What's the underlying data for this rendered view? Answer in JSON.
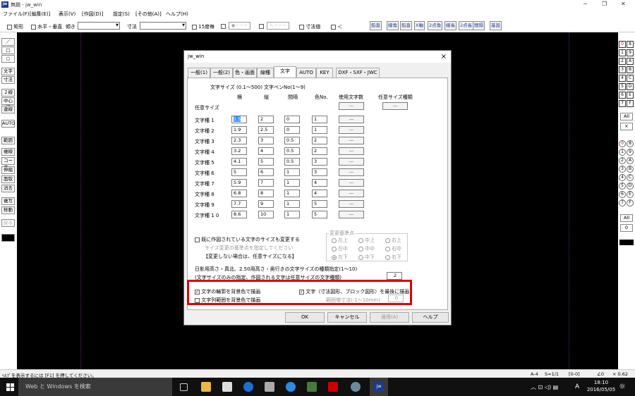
{
  "window": {
    "title": "無題 - jw_win",
    "logo": "jw"
  },
  "menu": [
    "ファイル(F)",
    "[編集(E)]",
    "表示(V)",
    "[作図(D)]",
    "設定(S)",
    "[その他(A)]",
    "ヘルプ(H)"
  ],
  "toolbar": {
    "rect": "矩形",
    "hv": "水平・垂直",
    "tilt": "傾き",
    "dim": "寸法",
    "deg15": "15度毎",
    "dots1": "●－－－",
    "dots2": "＜－－－",
    "dimval": "寸法値",
    "lt": "＜",
    "buttons": [
      "鉛直",
      "線角",
      "鉛直",
      "X軸",
      "2点角",
      "線長",
      "2点長",
      "間隔",
      "基設"
    ]
  },
  "left_tools": [
    "／",
    "□",
    "○",
    "文字",
    "寸法",
    "２線",
    "中心線",
    "連線",
    "AUTO",
    "範囲",
    "複線",
    "コーナー",
    "伸縮",
    "面取",
    "消去",
    "複写",
    "移動",
    "戻る",
    "━"
  ],
  "right_tools": {
    "sq": [
      "0",
      "1",
      "2",
      "3",
      "4",
      "5",
      "6",
      "7"
    ],
    "sq2": [
      "8",
      "9",
      "A",
      "B",
      "C",
      "D",
      "E",
      "F"
    ],
    "all1": "All",
    "x": "×",
    "circ": [
      "0",
      "1",
      "2",
      "3",
      "4",
      "5",
      "6",
      "7"
    ],
    "circ2": [
      "8",
      "9",
      "A",
      "B",
      "C",
      "D",
      "E",
      "F"
    ],
    "all2": "All",
    "zero": "0"
  },
  "status": {
    "help": "ﾍﾙﾌﾟを表示するには [F1] を押してください。",
    "paper": "A-4",
    "scale": "S=1/1",
    "layer": "[0-0]",
    "angle": "∠0",
    "zoom": "× 0.62"
  },
  "taskbar": {
    "search": "Web と Windows を検索",
    "time": "18:10",
    "date": "2016/05/05",
    "lang": "A"
  },
  "dialog": {
    "title": "jw_win",
    "close": "×",
    "tabs": [
      "一般(1)",
      "一般(2)",
      "色・画面",
      "線種",
      "文字",
      "AUTO",
      "KEY",
      "DXF・SXF・JWC"
    ],
    "hdr1": "文字サイズ (0.1～500)",
    "hdr2": "文字ペンNo(1～9)",
    "cols": [
      "横",
      "縦",
      "間隔",
      "色No.",
      "使用文字数",
      "任意サイズ種類"
    ],
    "free_label": "任意サイズ",
    "free_used": "---",
    "free_kind": "---",
    "rows": [
      {
        "label": "文字種 1",
        "w": "1.5",
        "h": "2",
        "gap": "0",
        "color": "1",
        "used": "---"
      },
      {
        "label": "文字種 2",
        "w": "1.9",
        "h": "2.5",
        "gap": "0",
        "color": "1",
        "used": "---"
      },
      {
        "label": "文字種 3",
        "w": "2.3",
        "h": "3",
        "gap": "0.5",
        "color": "2",
        "used": "---"
      },
      {
        "label": "文字種 4",
        "w": "3.2",
        "h": "4",
        "gap": "0.5",
        "color": "2",
        "used": "---"
      },
      {
        "label": "文字種 5",
        "w": "4.1",
        "h": "5",
        "gap": "0.5",
        "color": "3",
        "used": "---"
      },
      {
        "label": "文字種 6",
        "w": "5",
        "h": "6",
        "gap": "1",
        "color": "3",
        "used": "---"
      },
      {
        "label": "文字種 7",
        "w": "5.9",
        "h": "7",
        "gap": "1",
        "color": "4",
        "used": "---"
      },
      {
        "label": "文字種 8",
        "w": "6.8",
        "h": "8",
        "gap": "1",
        "color": "4",
        "used": "---"
      },
      {
        "label": "文字種 9",
        "w": "7.7",
        "h": "9",
        "gap": "1",
        "color": "5",
        "used": "---"
      },
      {
        "label": "文字種 1 0",
        "w": "8.6",
        "h": "10",
        "gap": "1",
        "color": "5",
        "used": "---"
      }
    ],
    "change_chk": "既に作図されている文字のサイズも変更する",
    "change_note1": "サイズ変更の基準点を指定してください",
    "change_note2": "【変更しない場合は、任意サイズになる】",
    "base_group": "変更基準点",
    "base": [
      "左上",
      "中上",
      "右上",
      "左中",
      "中中",
      "右中",
      "左下",
      "中下",
      "右下"
    ],
    "shadow1": "日影用高さ・真北、2.50用高さ・奥行きの文字サイズの種類指定(1～10)",
    "shadow2": "(文字サイズのみの指定、作図される文字は任意サイズの文字種類)",
    "shadow_val": "2",
    "outline_chk": "文字の輪郭を背景色で描画",
    "last_chk": "文字（寸法図形、ブロック図形）を最後に描画",
    "range_chk": "文字列範囲を背景色で描画",
    "range_lbl": "範囲増寸法(-1～10mm)",
    "range_val": "0",
    "ok": "OK",
    "cancel": "キャンセル",
    "apply": "適用(A)",
    "help": "ヘルプ"
  }
}
